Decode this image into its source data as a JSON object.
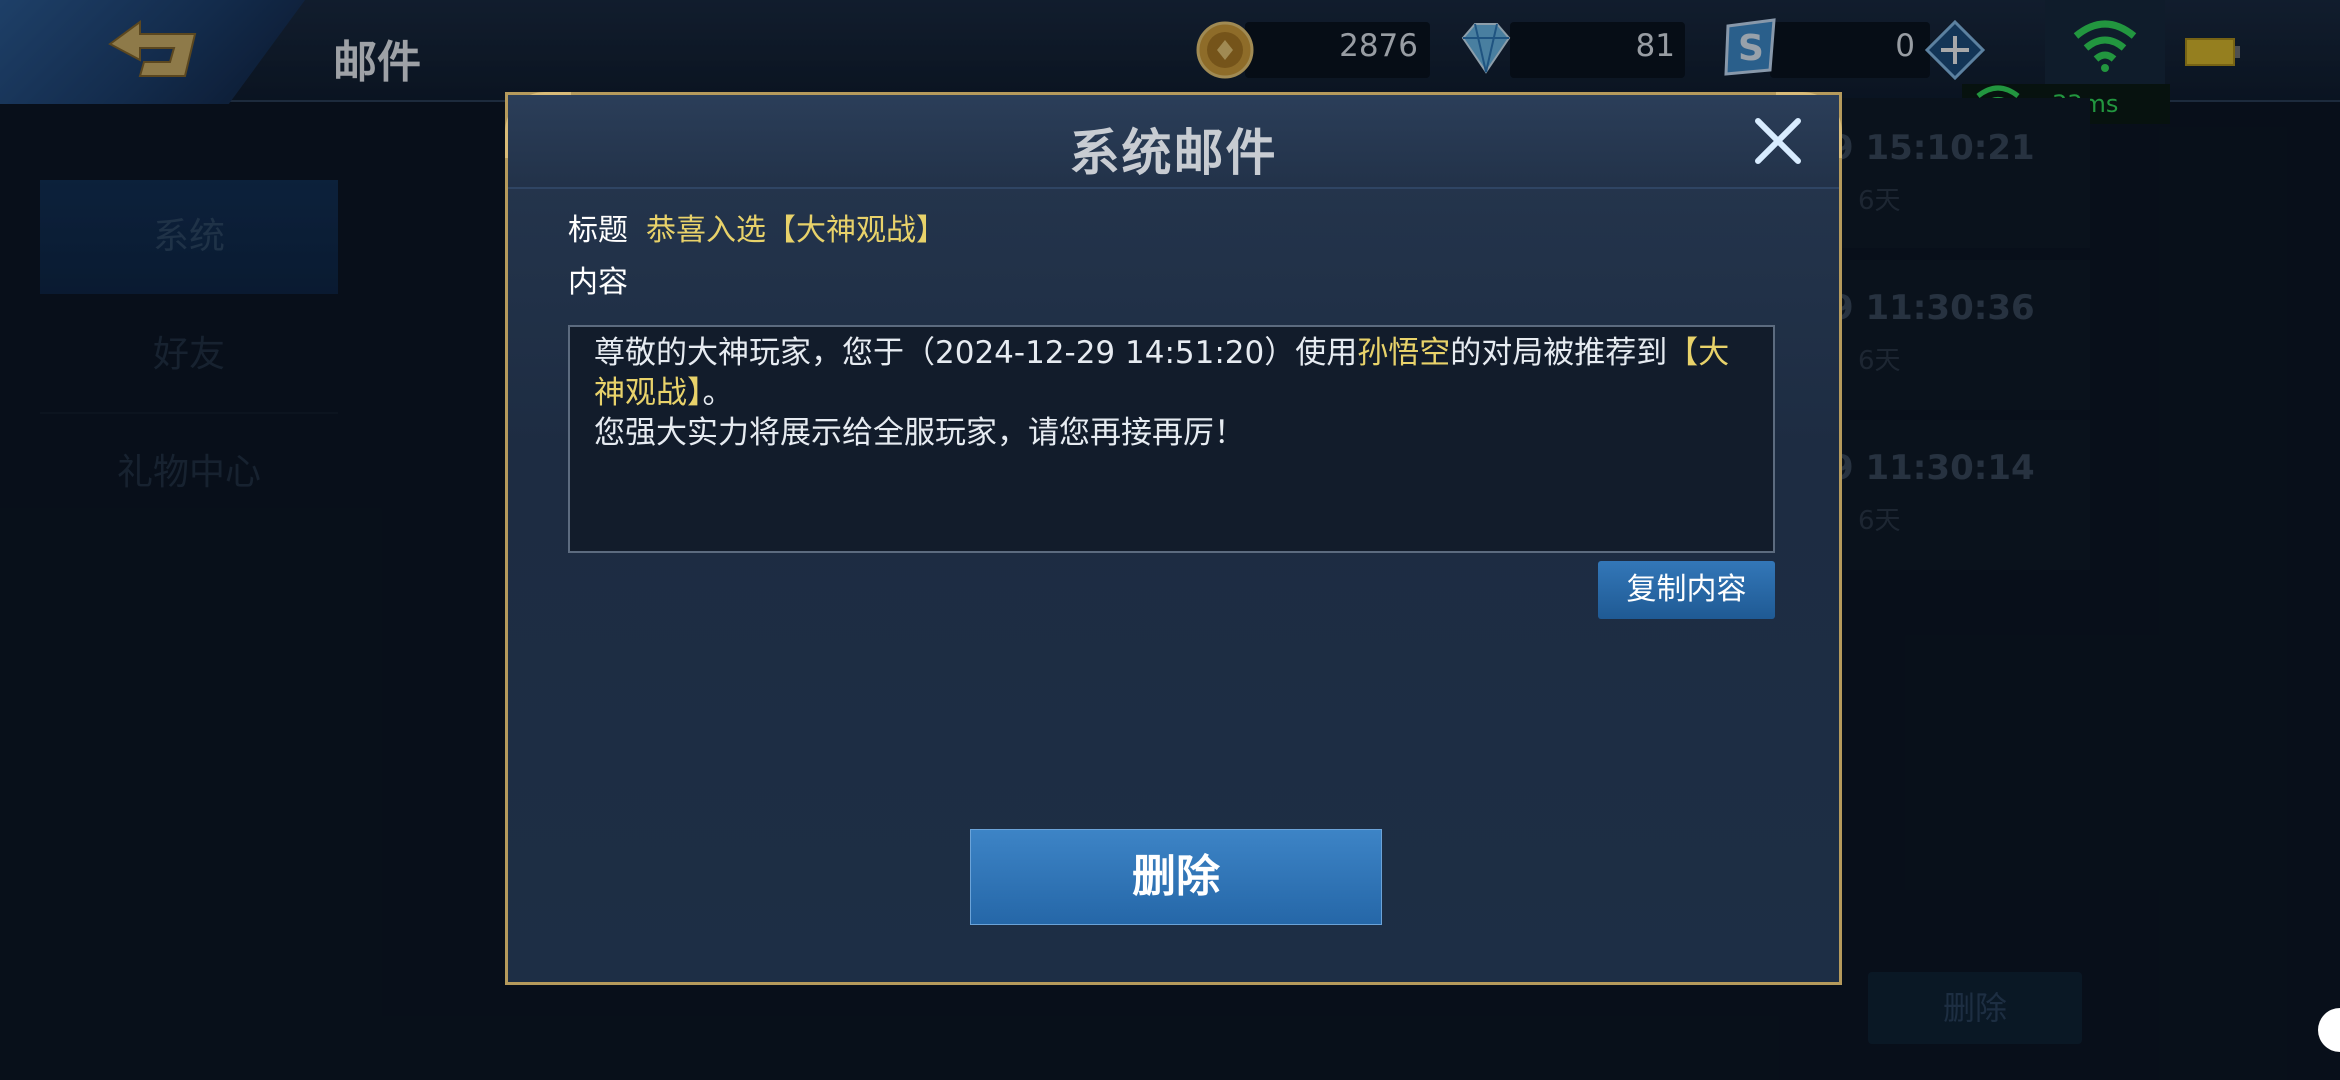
{
  "header": {
    "title": "邮件",
    "gold": "2876",
    "diamonds": "81",
    "vouchers": "0",
    "ping": "33ms"
  },
  "sidebar": {
    "items": [
      {
        "label": "系统",
        "active": true
      },
      {
        "label": "好友",
        "active": false
      },
      {
        "label": "礼物中心",
        "active": false
      }
    ]
  },
  "mail_list": {
    "rows": [
      {
        "time": "9 15:10:21",
        "days": "6天"
      },
      {
        "time": "9 11:30:36",
        "days": "6天"
      },
      {
        "time": "9 11:30:14",
        "days": "6天"
      }
    ],
    "delete_label": "删除"
  },
  "dialog": {
    "title": "系统邮件",
    "subject_label": "标题",
    "subject": "恭喜入选【大神观战】",
    "content_label": "内容",
    "content": {
      "part1": "尊敬的大神玩家，您于（2024-12-29 14:51:20）使用",
      "hero": "孙悟空",
      "part2": "的对局被推荐到",
      "tag": "【大神观战】",
      "part3": "。",
      "line2": "您强大实力将展示给全服玩家，请您再接再厉！"
    },
    "copy_label": "复制内容",
    "delete_label": "删除"
  },
  "colors": {
    "accent_gold": "#e8d26a",
    "button_blue": "#2d72b5",
    "frame_gold": "#b59a5c",
    "ping_green": "#33e35b"
  }
}
